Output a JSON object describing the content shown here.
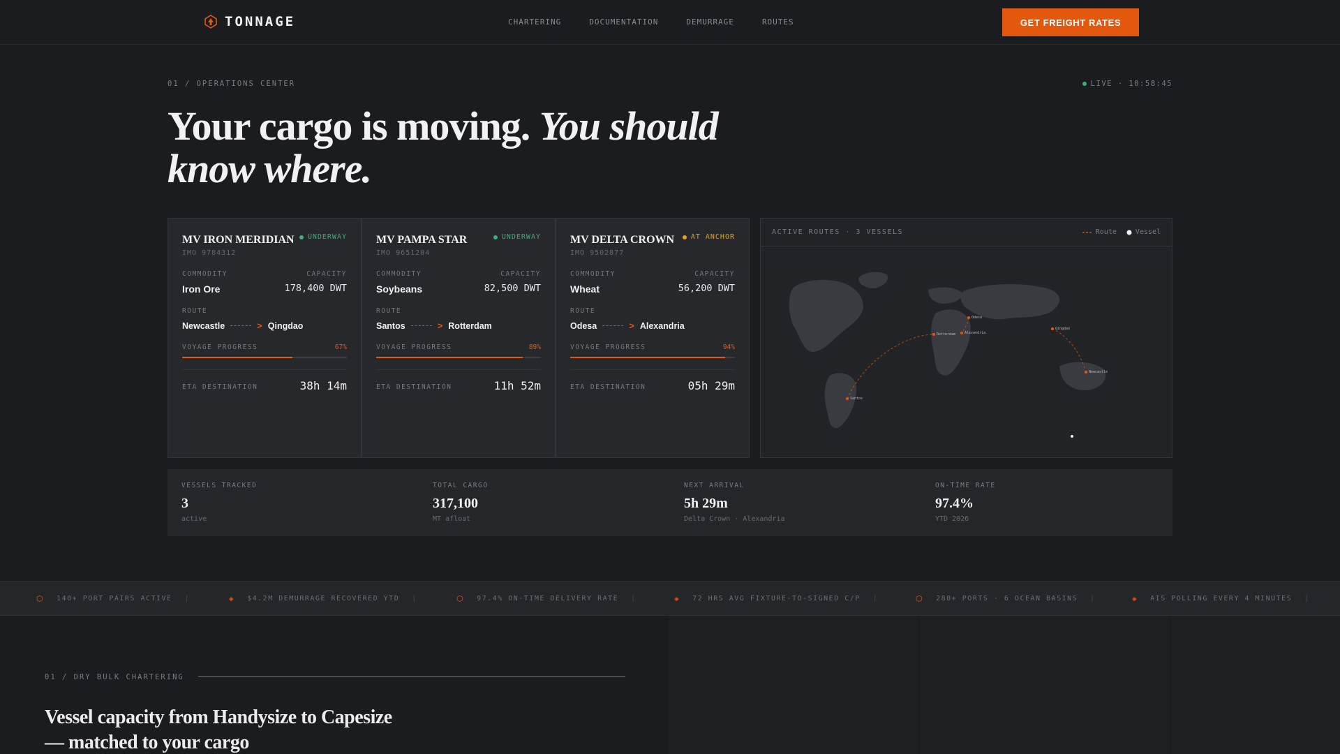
{
  "nav": {
    "brand": "TONNAGE",
    "links": [
      "CHARTERING",
      "DOCUMENTATION",
      "DEMURRAGE",
      "ROUTES"
    ],
    "cta": "GET FREIGHT RATES"
  },
  "hero": {
    "eyebrow": "01 / OPERATIONS CENTER",
    "live": "LIVE · 10:58:45",
    "title_plain": "Your cargo is moving. ",
    "title_italic": "You should know where."
  },
  "labels": {
    "commodity": "COMMODITY",
    "capacity": "CAPACITY",
    "route": "ROUTE",
    "progress": "VOYAGE PROGRESS",
    "eta": "ETA DESTINATION"
  },
  "vessels": [
    {
      "name": "MV IRON MERIDIAN",
      "status": "UNDERWAY",
      "status_color": "#3fae7c",
      "imo": "IMO 9784312",
      "commodity": "Iron Ore",
      "capacity": "178,400 DWT",
      "from": "Newcastle",
      "to": "Qingdao",
      "progress_pct": "67%",
      "progress": 0.67,
      "eta": "38h 14m"
    },
    {
      "name": "MV PAMPA STAR",
      "status": "UNDERWAY",
      "status_color": "#3fae7c",
      "imo": "IMO 9651204",
      "commodity": "Soybeans",
      "capacity": "82,500 DWT",
      "from": "Santos",
      "to": "Rotterdam",
      "progress_pct": "89%",
      "progress": 0.89,
      "eta": "11h 52m"
    },
    {
      "name": "MV DELTA CROWN",
      "status": "AT ANCHOR",
      "status_color": "#e0a41e",
      "imo": "IMO 9502877",
      "commodity": "Wheat",
      "capacity": "56,200 DWT",
      "from": "Odesa",
      "to": "Alexandria",
      "progress_pct": "94%",
      "progress": 0.94,
      "eta": "05h 29m"
    }
  ],
  "map": {
    "title": "ACTIVE ROUTES · 3 VESSELS",
    "legend_route": "Route",
    "legend_vessel": "Vessel",
    "ports": [
      "Santos",
      "Rotterdam",
      "Alexandria",
      "Odesa",
      "Qingdao",
      "Newcastle"
    ]
  },
  "stats": [
    {
      "label": "VESSELS TRACKED",
      "value": "3",
      "sub": "active"
    },
    {
      "label": "TOTAL CARGO",
      "value": "317,100",
      "sub": "MT afloat"
    },
    {
      "label": "NEXT ARRIVAL",
      "value": "5h 29m",
      "sub": "Delta Crown · Alexandria"
    },
    {
      "label": "ON-TIME RATE",
      "value": "97.4%",
      "sub": "YTD 2026"
    }
  ],
  "ticker": [
    "140+ PORT PAIRS ACTIVE",
    "$4.2M DEMURRAGE RECOVERED YTD",
    "97.4% ON-TIME DELIVERY RATE",
    "72 HRS AVG FIXTURE-TO-SIGNED C/P",
    "280+ PORTS · 6 OCEAN BASINS",
    "AIS POLLING EVERY 4 MINUTES"
  ],
  "section": {
    "eyebrow": "01 / DRY BULK CHARTERING",
    "title": "Vessel capacity from Handysize to Capesize — matched to your cargo"
  },
  "colors": {
    "accent": "#e4580e",
    "underway": "#3fae7c",
    "anchor": "#e0a41e"
  }
}
